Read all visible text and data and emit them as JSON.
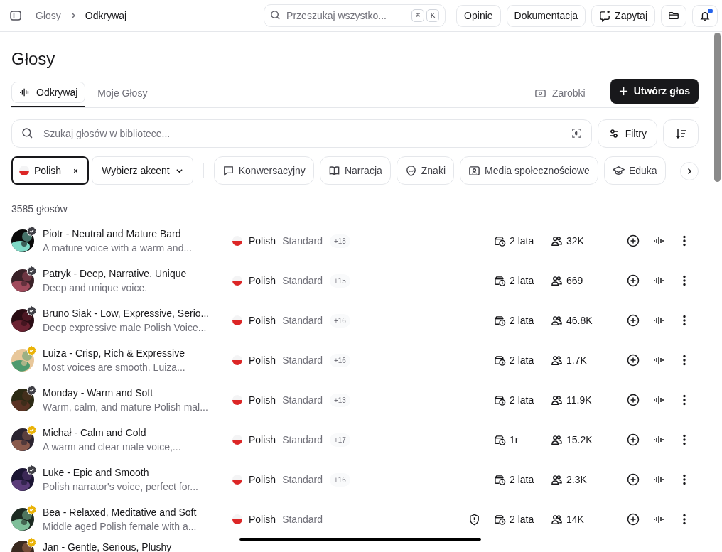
{
  "breadcrumb": [
    "Głosy",
    "Odkrywaj"
  ],
  "global_search": {
    "placeholder": "Przeszukaj wszystko...",
    "keys": [
      "⌘",
      "K"
    ]
  },
  "header_buttons": [
    "Opinie",
    "Dokumentacja",
    "Zapytaj"
  ],
  "notifications": {
    "unread": true
  },
  "title": "Głosy",
  "tabs": [
    {
      "label": "Odkrywaj",
      "selected": true
    },
    {
      "label": "Moje Głosy",
      "selected": false
    }
  ],
  "earnings_link": "Zarobki",
  "create_button": "Utwórz głos",
  "search": {
    "placeholder": "Szukaj głosów w bibliotece..."
  },
  "filters_button": "Filtry",
  "language_chip": {
    "label": "Polish",
    "selected": true
  },
  "accent_dropdown": "Wybierz akcent",
  "category_chips": [
    {
      "label": "Konwersacyjny",
      "kind": "chat"
    },
    {
      "label": "Narracja",
      "kind": "book"
    },
    {
      "label": "Znaki",
      "kind": "alien"
    },
    {
      "label": "Media społecznościowe",
      "kind": "portrait"
    },
    {
      "label": "Eduka",
      "kind": "cap"
    }
  ],
  "count": "3585 głosów",
  "voices": [
    {
      "name": "Piotr - Neutral and Mature Bard",
      "description": "A mature voice with a warm and...",
      "color": "#3f3f46",
      "language": "Polish",
      "accent": "Standard",
      "extra": "+18",
      "warning": false,
      "age": "2 lata",
      "users": "32K"
    },
    {
      "name": "Patryk - Deep, Narrative, Unique",
      "description": "Deep and unique voice.",
      "color": "#3f3f46",
      "language": "Polish",
      "accent": "Standard",
      "extra": "+15",
      "warning": false,
      "age": "2 lata",
      "users": "669"
    },
    {
      "name": "Bruno Siak - Low, Expressive, Serio...",
      "description": "Deep expressive male Polish Voice...",
      "color": "#3f3f46",
      "language": "Polish",
      "accent": "Standard",
      "extra": "+16",
      "warning": false,
      "age": "2 lata",
      "users": "46.8K"
    },
    {
      "name": "Luiza - Crisp, Rich & Expressive",
      "description": "Most voices are smooth. Luiza...",
      "color": "#eab308",
      "language": "Polish",
      "accent": "Standard",
      "extra": "+16",
      "warning": false,
      "age": "2 lata",
      "users": "1.7K"
    },
    {
      "name": "Monday - Warm and Soft",
      "description": "Warm, calm, and mature Polish mal...",
      "color": "#3f3f46",
      "language": "Polish",
      "accent": "Standard",
      "extra": "+13",
      "warning": false,
      "age": "2 lata",
      "users": "11.9K"
    },
    {
      "name": "Michał - Calm and Cold",
      "description": "A warm and clear male voice,...",
      "color": "#eab308",
      "language": "Polish",
      "accent": "Standard",
      "extra": "+17",
      "warning": false,
      "age": "1r",
      "users": "15.2K"
    },
    {
      "name": "Luke - Epic and Smooth",
      "description": "Polish narrator's voice, perfect for...",
      "color": "#3f3f46",
      "language": "Polish",
      "accent": "Standard",
      "extra": "+16",
      "warning": false,
      "age": "2 lata",
      "users": "2.3K"
    },
    {
      "name": "Bea - Relaxed, Meditative and Soft",
      "description": "Middle aged Polish female with a...",
      "color": "#eab308",
      "language": "Polish",
      "accent": "Standard",
      "warning": true,
      "age": "2 lata",
      "users": "14K"
    },
    {
      "name": "Jan - Gentle, Serious, Plushy",
      "color": "#eab308"
    }
  ]
}
